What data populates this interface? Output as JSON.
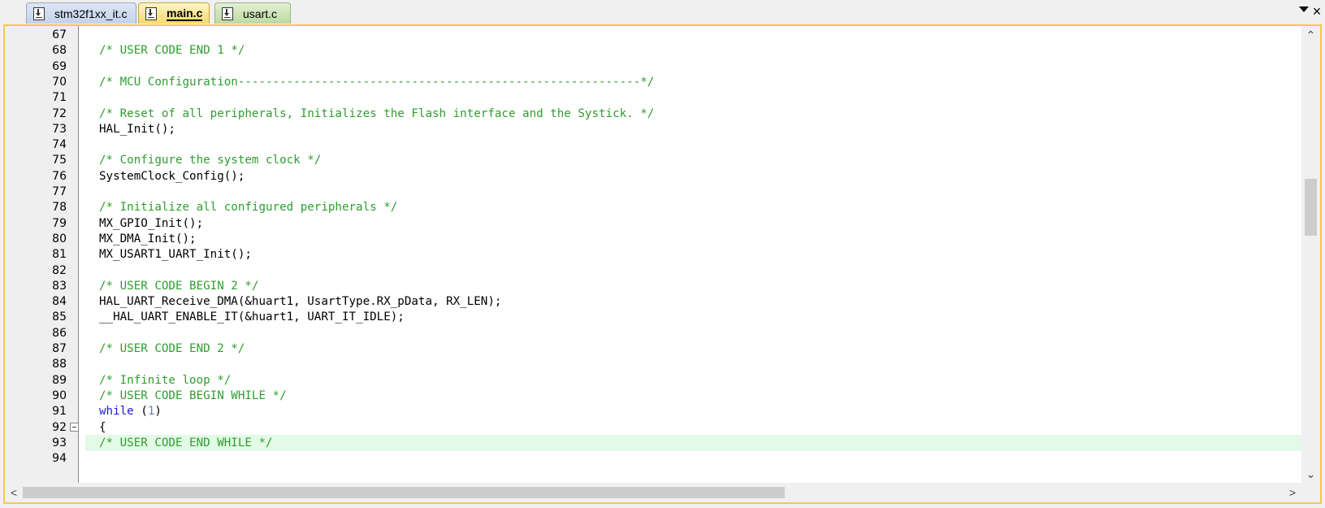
{
  "tabs": [
    {
      "label": "stm32f1xx_it.c",
      "icon": "file-download-icon"
    },
    {
      "label": "main.c",
      "icon": "file-download-icon",
      "active": true
    },
    {
      "label": "usart.c",
      "icon": "file-download-icon"
    }
  ],
  "tab_controls": {
    "dropdown_icon": "chevron-down-icon",
    "close_glyph": "×"
  },
  "colors": {
    "comment": "#2e9e2e",
    "keyword": "#1b1bd6",
    "number": "#6a7bb8",
    "current_line": "#e3fae6",
    "active_tab": "#f7d96a",
    "frame": "#f5c84a"
  },
  "editor": {
    "lines": [
      {
        "num": "67",
        "segments": []
      },
      {
        "num": "68",
        "segments": [
          {
            "t": "/* USER CODE END 1 */",
            "c": "cm"
          }
        ]
      },
      {
        "num": "69",
        "segments": []
      },
      {
        "num": "70",
        "segments": [
          {
            "t": "/* MCU Configuration----------------------------------------------------------*/",
            "c": "cm"
          }
        ]
      },
      {
        "num": "71",
        "segments": []
      },
      {
        "num": "72",
        "segments": [
          {
            "t": "/* Reset of all peripherals, Initializes the Flash interface and the Systick. */",
            "c": "cm"
          }
        ]
      },
      {
        "num": "73",
        "segments": [
          {
            "t": "HAL_Init();",
            "c": ""
          }
        ]
      },
      {
        "num": "74",
        "segments": []
      },
      {
        "num": "75",
        "segments": [
          {
            "t": "/* Configure the system clock */",
            "c": "cm"
          }
        ]
      },
      {
        "num": "76",
        "segments": [
          {
            "t": "SystemClock_Config();",
            "c": ""
          }
        ]
      },
      {
        "num": "77",
        "segments": []
      },
      {
        "num": "78",
        "segments": [
          {
            "t": "/* Initialize all configured peripherals */",
            "c": "cm"
          }
        ]
      },
      {
        "num": "79",
        "segments": [
          {
            "t": "MX_GPIO_Init();",
            "c": ""
          }
        ]
      },
      {
        "num": "80",
        "segments": [
          {
            "t": "MX_DMA_Init();",
            "c": ""
          }
        ]
      },
      {
        "num": "81",
        "segments": [
          {
            "t": "MX_USART1_UART_Init();",
            "c": ""
          }
        ]
      },
      {
        "num": "82",
        "segments": []
      },
      {
        "num": "83",
        "segments": [
          {
            "t": "/* USER CODE BEGIN 2 */",
            "c": "cm"
          }
        ]
      },
      {
        "num": "84",
        "segments": [
          {
            "t": "HAL_UART_Receive_DMA(&huart1, UsartType.RX_pData, RX_LEN);",
            "c": ""
          }
        ]
      },
      {
        "num": "85",
        "segments": [
          {
            "t": "__HAL_UART_ENABLE_IT(&huart1, UART_IT_IDLE);",
            "c": ""
          }
        ]
      },
      {
        "num": "86",
        "segments": []
      },
      {
        "num": "87",
        "segments": [
          {
            "t": "/* USER CODE END 2 */",
            "c": "cm"
          }
        ]
      },
      {
        "num": "88",
        "segments": []
      },
      {
        "num": "89",
        "segments": [
          {
            "t": "/* Infinite loop */",
            "c": "cm"
          }
        ]
      },
      {
        "num": "90",
        "segments": [
          {
            "t": "/* USER CODE BEGIN WHILE */",
            "c": "cm"
          }
        ]
      },
      {
        "num": "91",
        "segments": [
          {
            "t": "while",
            "c": "kw"
          },
          {
            "t": " (",
            "c": ""
          },
          {
            "t": "1",
            "c": "num"
          },
          {
            "t": ")",
            "c": ""
          }
        ]
      },
      {
        "num": "92",
        "segments": [
          {
            "t": "{",
            "c": ""
          }
        ],
        "fold": true
      },
      {
        "num": "93",
        "segments": [
          {
            "t": "/* USER CODE END WHILE */",
            "c": "cm"
          }
        ],
        "current": true
      },
      {
        "num": "94",
        "segments": []
      }
    ]
  },
  "scrollbars": {
    "up_glyph": "⌃",
    "down_glyph": "⌄",
    "left_glyph": "<",
    "right_glyph": ">"
  }
}
